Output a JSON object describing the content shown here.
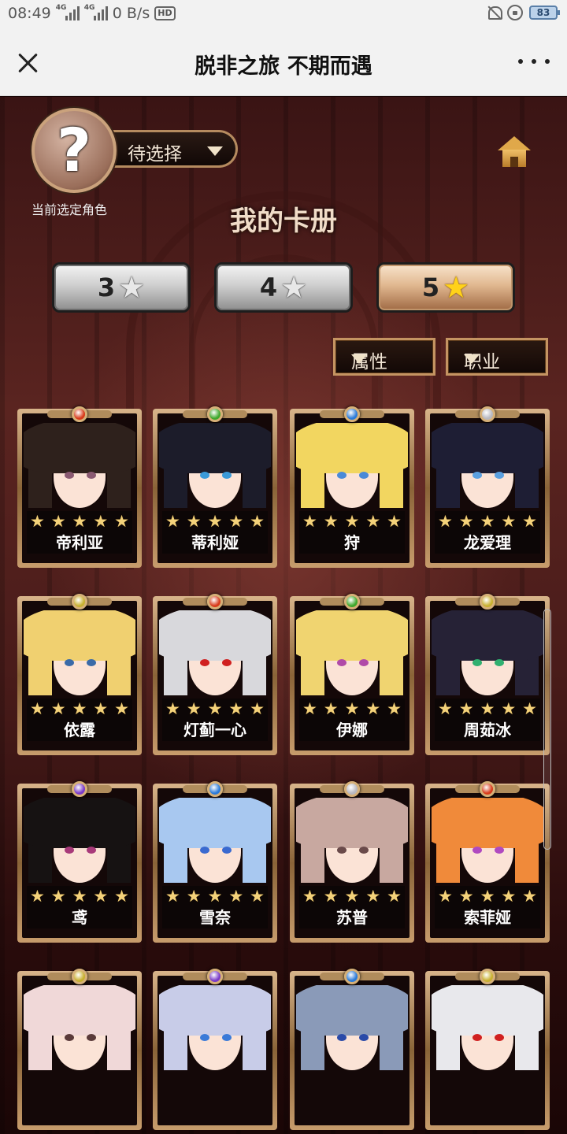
{
  "status_bar": {
    "time": "08:49",
    "net_tag_1": "4G",
    "net_tag_2": "4G",
    "speed": "0 B/s",
    "hd": "HD",
    "battery": "83"
  },
  "header": {
    "title": "脱非之旅 不期而遇",
    "close_icon": "close-icon",
    "more_icon": "more-icon"
  },
  "selector": {
    "question_mark": "?",
    "value": "待选择",
    "caption": "当前选定角色"
  },
  "section_title": "我的卡册",
  "rarity_tabs": [
    {
      "label": "3",
      "star": "★",
      "active": false
    },
    {
      "label": "4",
      "star": "★",
      "active": false
    },
    {
      "label": "5",
      "star": "★",
      "active": true
    }
  ],
  "filters": {
    "attribute": "属性",
    "job": "职业"
  },
  "card_stars": "★",
  "cards": [
    {
      "name": "帝利亚",
      "gem": "#d83a1a",
      "hair": "#2e211c",
      "eyes": "#8a5a72"
    },
    {
      "name": "蒂利娅",
      "gem": "#3fa82c",
      "hair": "#1c1c2a",
      "eyes": "#3a9ad8"
    },
    {
      "name": "狩",
      "gem": "#2a7ad8",
      "hair": "#f2d660",
      "eyes": "#4a8ad8"
    },
    {
      "name": "龙爱理",
      "gem": "#b8b8c0",
      "hair": "#1e1e34",
      "eyes": "#5aa0e0"
    },
    {
      "name": "依露",
      "gem": "#c8b030",
      "hair": "#f0d070",
      "eyes": "#3a6aa8"
    },
    {
      "name": "灯蓟一心",
      "gem": "#d83a1a",
      "hair": "#d8d8dc",
      "eyes": "#d02020"
    },
    {
      "name": "伊娜",
      "gem": "#3fa82c",
      "hair": "#f0d470",
      "eyes": "#b04aa8"
    },
    {
      "name": "周茹冰",
      "gem": "#c8b030",
      "hair": "#262236",
      "eyes": "#30b070"
    },
    {
      "name": "鸢",
      "gem": "#7a3ac8",
      "hair": "#161212",
      "eyes": "#a83a7a"
    },
    {
      "name": "雪奈",
      "gem": "#2a7ad8",
      "hair": "#a8c8f0",
      "eyes": "#3a6ad0"
    },
    {
      "name": "苏普",
      "gem": "#b8b8c0",
      "hair": "#c8a8a0",
      "eyes": "#6a4a4a"
    },
    {
      "name": "索菲娅",
      "gem": "#d83a1a",
      "hair": "#f08a3a",
      "eyes": "#b04ac0"
    },
    {
      "name": "",
      "gem": "#c8b030",
      "hair": "#f0d8d8",
      "eyes": "#5a3a3a"
    },
    {
      "name": "",
      "gem": "#7a3ac8",
      "hair": "#c8cce8",
      "eyes": "#3a7ad8"
    },
    {
      "name": "",
      "gem": "#2a7ad8",
      "hair": "#8a9ab8",
      "eyes": "#2a4aa8"
    },
    {
      "name": "",
      "gem": "#c8b030",
      "hair": "#e8e8ec",
      "eyes": "#d02020"
    }
  ],
  "colors": {
    "accent_gold": "#c49462",
    "title_text": "#f0dcc8"
  }
}
